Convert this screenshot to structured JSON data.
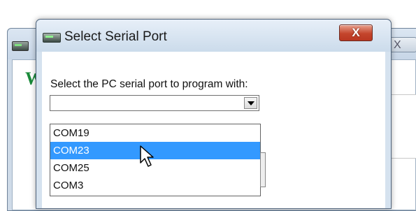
{
  "background_window": {
    "close_glyph": "X",
    "logo_glyph": "W"
  },
  "dialog": {
    "title": "Select Serial Port",
    "close_glyph": "X",
    "prompt": "Select the PC serial port to program with:",
    "selected_value": "",
    "port_options": [
      {
        "label": "COM19",
        "selected": false
      },
      {
        "label": "COM23",
        "selected": true
      },
      {
        "label": "COM25",
        "selected": false
      },
      {
        "label": "COM3",
        "selected": false
      }
    ]
  },
  "colors": {
    "selection": "#3399ff",
    "close_button": "#c4452c"
  },
  "icons": [
    "serial-port-icon",
    "close-icon",
    "dropdown-arrow-icon",
    "mouse-cursor-icon"
  ]
}
